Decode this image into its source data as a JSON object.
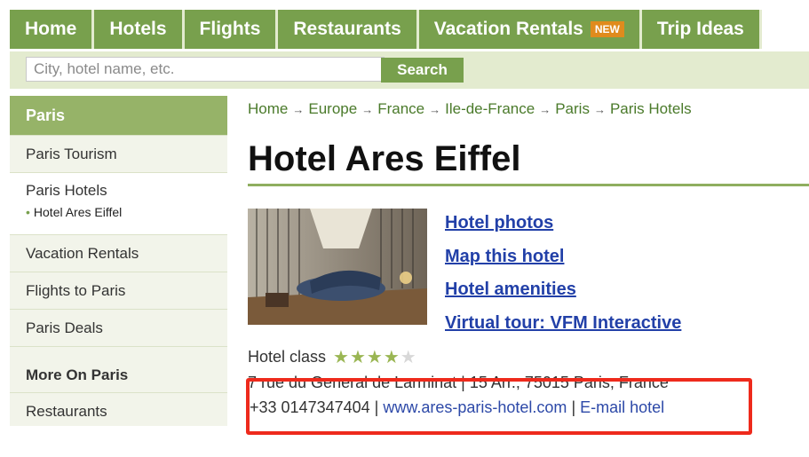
{
  "nav": {
    "tabs": [
      {
        "label": "Home"
      },
      {
        "label": "Hotels"
      },
      {
        "label": "Flights"
      },
      {
        "label": "Restaurants"
      },
      {
        "label": "Vacation Rentals",
        "badge": "NEW"
      },
      {
        "label": "Trip Ideas"
      }
    ]
  },
  "search": {
    "placeholder": "City, hotel name, etc.",
    "button": "Search"
  },
  "sidebar": {
    "header": "Paris",
    "items": [
      {
        "label": "Paris Tourism"
      },
      {
        "label": "Paris Hotels",
        "sub": "Hotel Ares Eiffel"
      },
      {
        "label": "Vacation Rentals"
      },
      {
        "label": "Flights to Paris"
      },
      {
        "label": "Paris Deals"
      }
    ],
    "more_header": "More On Paris",
    "more_items": [
      {
        "label": "Restaurants"
      }
    ]
  },
  "breadcrumb": [
    "Home",
    "Europe",
    "France",
    "Ile-de-France",
    "Paris",
    "Paris Hotels"
  ],
  "hotel": {
    "name": "Hotel Ares Eiffel",
    "links": [
      "Hotel photos",
      "Map this hotel",
      "Hotel amenities",
      "Virtual tour: VFM Interactive"
    ],
    "class_label": "Hotel class",
    "stars": 4,
    "stars_max": 5,
    "address": "7 rue du General de Larminat | 15 Arr., 75015 Paris, France",
    "phone": "+33 0147347404",
    "website": "www.ares-paris-hotel.com",
    "email_label": "E-mail hotel"
  },
  "colors": {
    "nav_green": "#78a04d",
    "highlight_red": "#ee2a1c",
    "link_blue": "#2240a8"
  }
}
